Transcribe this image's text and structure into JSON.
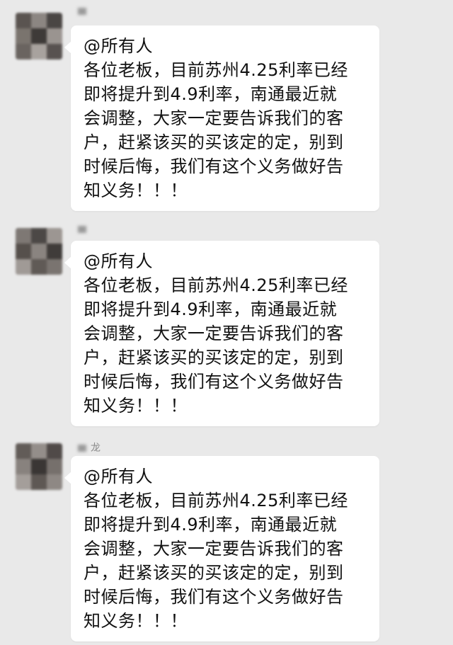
{
  "messages": [
    {
      "sender": "",
      "lines": [
        "@所有人",
        "各位老板，目前苏州4.25利率已经",
        "即将提升到4.9利率，南通最近就",
        "会调整，大家一定要告诉我们的客",
        "户，赶紧该买的买该定的定，别到",
        "时候后悔，我们有这个义务做好告",
        "知义务！！！"
      ]
    },
    {
      "sender": "",
      "lines": [
        "@所有人",
        "各位老板，目前苏州4.25利率已经",
        "即将提升到4.9利率，南通最近就",
        "会调整，大家一定要告诉我们的客",
        "户，赶紧该买的买该定的定，别到",
        "时候后悔，我们有这个义务做好告",
        "知义务！！！"
      ]
    },
    {
      "sender": "龙",
      "lines": [
        "@所有人",
        "各位老板，目前苏州4.25利率已经",
        "即将提升到4.9利率，南通最近就",
        "会调整，大家一定要告诉我们的客",
        "户，赶紧该买的买该定的定，别到",
        "时候后悔，我们有这个义务做好告",
        "知义务！！！"
      ]
    }
  ]
}
